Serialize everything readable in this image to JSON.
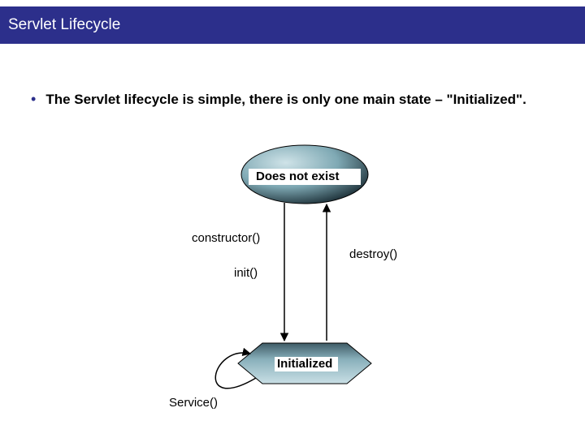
{
  "title": "Servlet Lifecycle",
  "bullet_text": "The Servlet lifecycle is simple, there is only one main state – \"Initialized\".",
  "diagram": {
    "state_top": "Does not exist",
    "state_bottom": "Initialized",
    "label_constructor": "constructor()",
    "label_init": "init()",
    "label_destroy": "destroy()",
    "label_service": "Service()"
  },
  "chart_data": {
    "type": "state-diagram",
    "states": [
      "Does not exist",
      "Initialized"
    ],
    "transitions": [
      {
        "from": "Does not exist",
        "to": "Initialized",
        "label": "constructor() then init()"
      },
      {
        "from": "Initialized",
        "to": "Does not exist",
        "label": "destroy()"
      },
      {
        "from": "Initialized",
        "to": "Initialized",
        "label": "Service()"
      }
    ]
  }
}
